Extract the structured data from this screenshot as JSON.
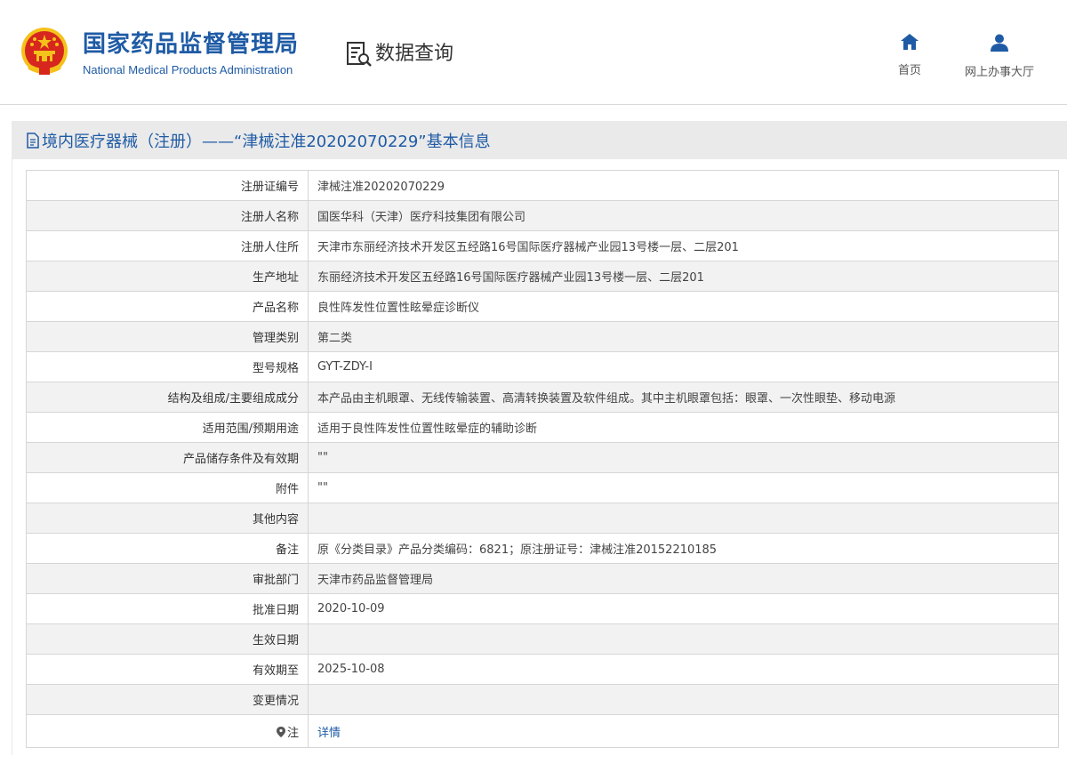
{
  "header": {
    "agency_cn": "国家药品监督管理局",
    "agency_en": "National Medical Products Administration",
    "query_label": "数据查询",
    "nav": [
      {
        "label": "首页",
        "icon": "home-icon"
      },
      {
        "label": "网上办事大厅",
        "icon": "user-icon"
      }
    ]
  },
  "page": {
    "title": "境内医疗器械（注册）——“津械注准20202070229”基本信息"
  },
  "colors": {
    "brand_blue": "#1f5ba5",
    "emblem_red": "#d6261e",
    "emblem_gold": "#f4c21a",
    "row_stripe": "#f2f2f2"
  },
  "record": {
    "rows": [
      {
        "label": "注册证编号",
        "value": "津械注准20202070229"
      },
      {
        "label": "注册人名称",
        "value": "国医华科（天津）医疗科技集团有限公司"
      },
      {
        "label": "注册人住所",
        "value": "天津市东丽经济技术开发区五经路16号国际医疗器械产业园13号楼一层、二层201"
      },
      {
        "label": "生产地址",
        "value": "东丽经济技术开发区五经路16号国际医疗器械产业园13号楼一层、二层201"
      },
      {
        "label": "产品名称",
        "value": "良性阵发性位置性眩晕症诊断仪"
      },
      {
        "label": "管理类别",
        "value": "第二类"
      },
      {
        "label": "型号规格",
        "value": "GYT-ZDY-I"
      },
      {
        "label": "结构及组成/主要组成成分",
        "value": "本产品由主机眼罩、无线传输装置、高清转换装置及软件组成。其中主机眼罩包括：眼罩、一次性眼垫、移动电源"
      },
      {
        "label": "适用范围/预期用途",
        "value": "适用于良性阵发性位置性眩晕症的辅助诊断"
      },
      {
        "label": "产品储存条件及有效期",
        "value": "\"\""
      },
      {
        "label": "附件",
        "value": "\"\""
      },
      {
        "label": "其他内容",
        "value": ""
      },
      {
        "label": "备注",
        "value": "原《分类目录》产品分类编码：6821；原注册证号：津械注准20152210185"
      },
      {
        "label": "审批部门",
        "value": "天津市药品监督管理局"
      },
      {
        "label": "批准日期",
        "value": "2020-10-09"
      },
      {
        "label": "生效日期",
        "value": ""
      },
      {
        "label": "有效期至",
        "value": "2025-10-08"
      },
      {
        "label": "变更情况",
        "value": ""
      }
    ],
    "note_label": "注",
    "note_link": "详情"
  }
}
